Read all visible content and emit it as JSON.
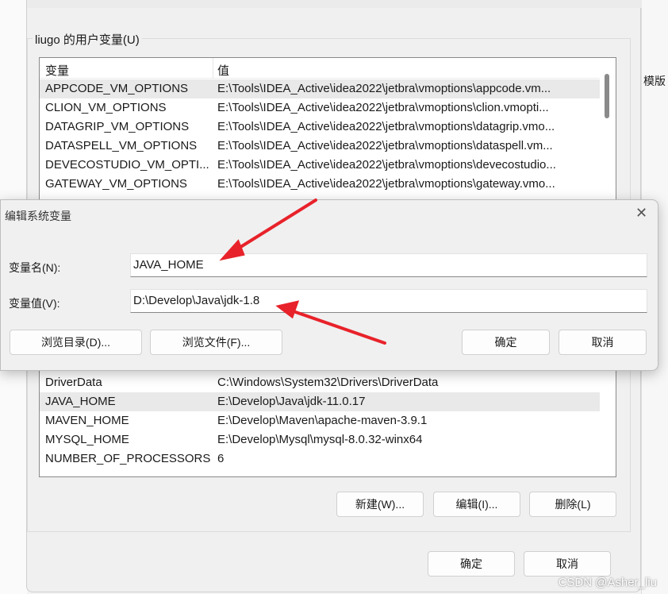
{
  "user_vars": {
    "group_label": "liugo 的用户变量(U)",
    "columns": [
      "变量",
      "值"
    ],
    "rows_top": [
      {
        "name": "APPCODE_VM_OPTIONS",
        "value": "E:\\Tools\\IDEA_Active\\idea2022\\jetbra\\vmoptions\\appcode.vm..."
      },
      {
        "name": "CLION_VM_OPTIONS",
        "value": "E:\\Tools\\IDEA_Active\\idea2022\\jetbra\\vmoptions\\clion.vmopti..."
      },
      {
        "name": "DATAGRIP_VM_OPTIONS",
        "value": "E:\\Tools\\IDEA_Active\\idea2022\\jetbra\\vmoptions\\datagrip.vmo..."
      },
      {
        "name": "DATASPELL_VM_OPTIONS",
        "value": "E:\\Tools\\IDEA_Active\\idea2022\\jetbra\\vmoptions\\dataspell.vm..."
      },
      {
        "name": "DEVECOSTUDIO_VM_OPTI...",
        "value": "E:\\Tools\\IDEA_Active\\idea2022\\jetbra\\vmoptions\\devecostudio..."
      },
      {
        "name": "GATEWAY_VM_OPTIONS",
        "value": "E:\\Tools\\IDEA_Active\\idea2022\\jetbra\\vmoptions\\gateway.vmo..."
      }
    ],
    "rows_bottom": [
      {
        "name": "DriverData",
        "value": "C:\\Windows\\System32\\Drivers\\DriverData"
      },
      {
        "name": "JAVA_HOME",
        "value": "E:\\Develop\\Java\\jdk-11.0.17"
      },
      {
        "name": "MAVEN_HOME",
        "value": "E:\\Develop\\Maven\\apache-maven-3.9.1"
      },
      {
        "name": "MYSQL_HOME",
        "value": "E:\\Develop\\Mysql\\mysql-8.0.32-winx64"
      },
      {
        "name": "NUMBER_OF_PROCESSORS",
        "value": "6"
      }
    ],
    "new_label": "新建(W)...",
    "edit_label": "编辑(I)...",
    "delete_label": "删除(L)",
    "ok_label": "确定",
    "cancel_label": "取消"
  },
  "edit_dialog": {
    "title": "编辑系统变量",
    "name_label": "变量名(N):",
    "name_value": "JAVA_HOME",
    "value_label": "变量值(V):",
    "value_value": "D:\\Develop\\Java\\jdk-1.8",
    "browse_dir": "浏览目录(D)...",
    "browse_file": "浏览文件(F)...",
    "ok": "确定",
    "cancel": "取消"
  },
  "background": {
    "right_label": "模版"
  },
  "watermark": "CSDN @Asher_liu",
  "colors": {
    "arrow": "#e8222a"
  }
}
